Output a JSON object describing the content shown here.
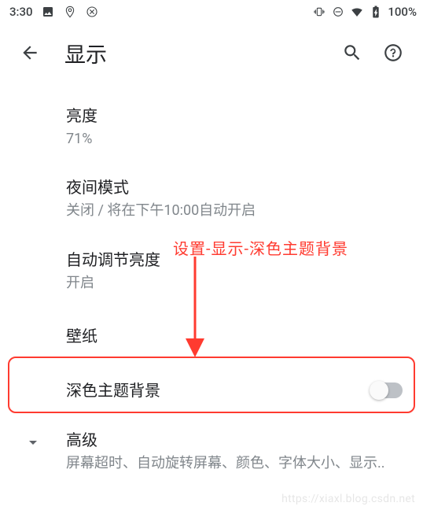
{
  "status": {
    "time": "3:30",
    "battery": "100%"
  },
  "appbar": {
    "title": "显示"
  },
  "items": {
    "brightness": {
      "title": "亮度",
      "sub": "71%"
    },
    "night": {
      "title": "夜间模式",
      "sub": "关闭 / 将在下午10:00自动开启"
    },
    "adaptive": {
      "title": "自动调节亮度",
      "sub": "开启"
    },
    "wallpaper": {
      "title": "壁纸"
    },
    "darktheme": {
      "title": "深色主题背景"
    },
    "advanced": {
      "title": "高级",
      "sub": "屏幕超时、自动旋转屏幕、颜色、字体大小、显示.."
    }
  },
  "annotation": {
    "label": "设置-显示-深色主题背景"
  },
  "watermark": "https://xiaxl.blog.csdn.net"
}
